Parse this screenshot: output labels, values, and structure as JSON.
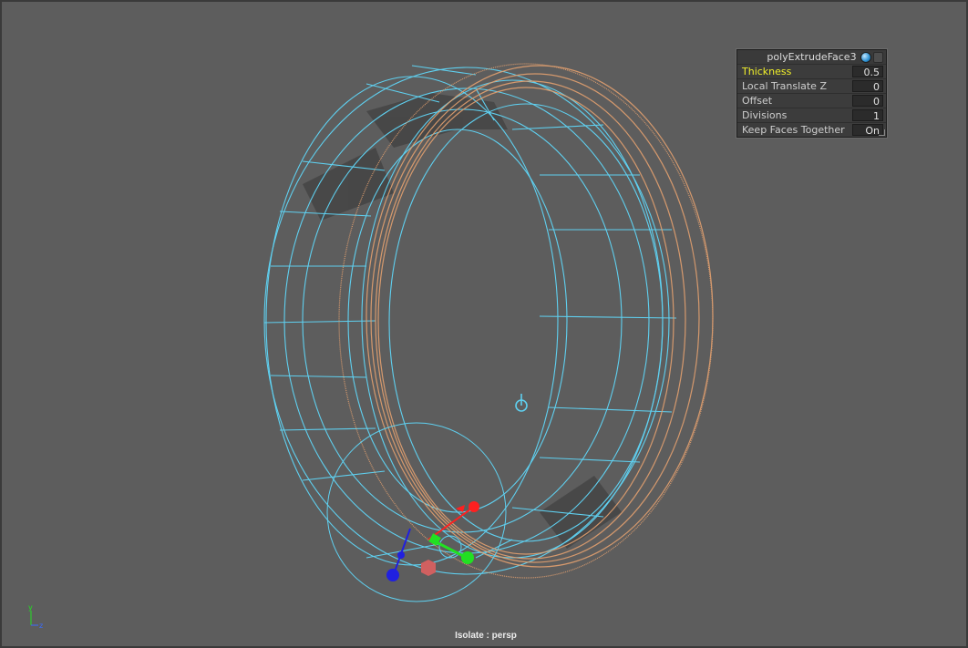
{
  "viewport": {
    "camera_label": "Isolate : persp",
    "axis_indicator": {
      "y_label": "y",
      "z_label": "z"
    }
  },
  "hud": {
    "title": "polyExtrudeFace3",
    "rows": [
      {
        "label": "Thickness",
        "value": "0.5",
        "highlighted": true
      },
      {
        "label": "Local Translate Z",
        "value": "0",
        "highlighted": false
      },
      {
        "label": "Offset",
        "value": "0",
        "highlighted": false
      },
      {
        "label": "Divisions",
        "value": "1",
        "highlighted": false
      },
      {
        "label": "Keep Faces Together",
        "value": "On",
        "highlighted": false
      }
    ]
  },
  "colors": {
    "background": "#5d5d5d",
    "wireframe": "#5fd0f0",
    "extruded_faces": "#e3a06f",
    "highlight_label": "#f0ef2a",
    "manip_x": "#ff2020",
    "manip_y": "#22e022",
    "manip_z": "#2020e0"
  }
}
